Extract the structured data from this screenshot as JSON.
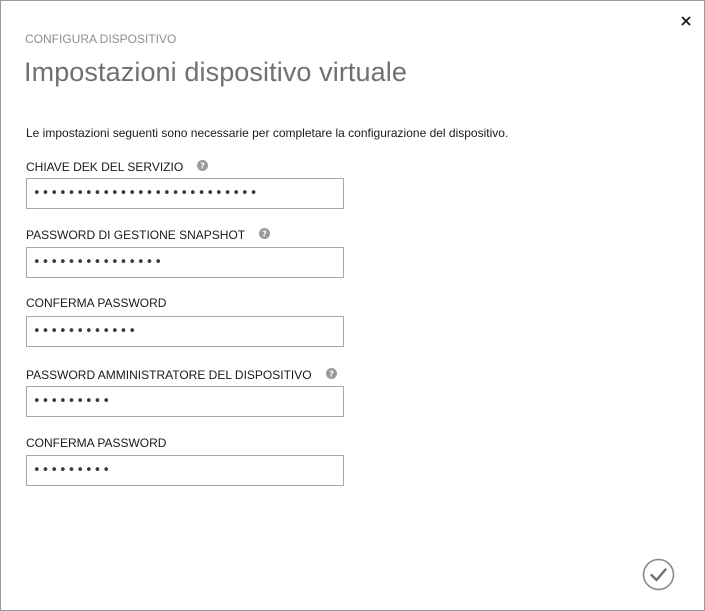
{
  "dialog": {
    "subtitle": "CONFIGURA DISPOSITIVO",
    "title": "Impostazioni dispositivo virtuale",
    "description": "Le impostazioni seguenti sono necessarie per completare la configurazione del dispositivo."
  },
  "fields": [
    {
      "label": "CHIAVE DEK DEL SERVIZIO",
      "value": "••••••••••••••••••••••••••",
      "has_help": true
    },
    {
      "label": "PASSWORD DI GESTIONE SNAPSHOT",
      "value": "•••••••••••••••",
      "has_help": true
    },
    {
      "label": "CONFERMA PASSWORD",
      "value": "••••••••••••",
      "has_help": false
    },
    {
      "label": "PASSWORD AMMINISTRATORE DEL DISPOSITIVO",
      "value": "•••••••••",
      "has_help": true
    },
    {
      "label": "CONFERMA PASSWORD",
      "value": "•••••••••",
      "has_help": false
    }
  ],
  "icons": {
    "close": "close-icon",
    "help": "help-icon",
    "confirm": "checkmark-icon"
  },
  "colors": {
    "title": "#707070",
    "subtitle": "#8e8e8e",
    "border": "#a8a8a8",
    "help_icon": "#9a9a9a"
  }
}
